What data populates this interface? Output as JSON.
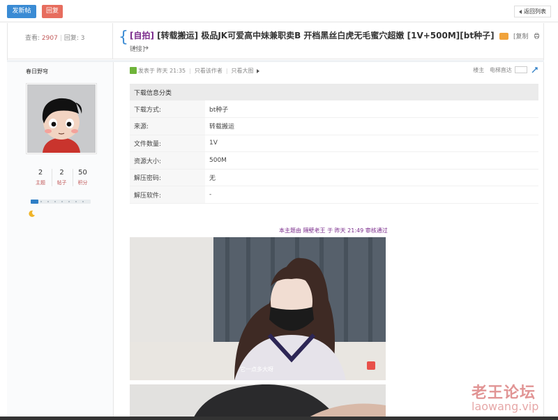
{
  "toolbar": {
    "new_post": "发新帖",
    "reply": "回复",
    "back": "返回列表"
  },
  "thread": {
    "views_label": "查看:",
    "views": "2907",
    "replies_label": "回复:",
    "replies": "3",
    "tag1": "[自拍]",
    "tag2": "[转载搬运]",
    "title": "极品JK可爱高中妹兼职卖B 开档黑丝白虎无毛蜜穴超嫩 [1V+500M][bt种子]",
    "copy_label": "[复制",
    "link_label": "链接]"
  },
  "author": {
    "name": "春日野穹",
    "stats": [
      {
        "value": "2",
        "label": "主题"
      },
      {
        "value": "2",
        "label": "帖子"
      },
      {
        "value": "50",
        "label": "积分"
      }
    ],
    "level_progress": 0.13
  },
  "post": {
    "posted_at": "发表于 昨天 21:35",
    "only_author": "只看该作者",
    "only_image": "只看大图",
    "role": "楼主",
    "goto_floor": "电梯直达",
    "table_title": "下载信息分类",
    "rows": [
      {
        "key": "下载方式:",
        "value": "bt种子"
      },
      {
        "key": "来源:",
        "value": "转载搬运"
      },
      {
        "key": "文件数量:",
        "value": "1V"
      },
      {
        "key": "资源大小:",
        "value": "500M"
      },
      {
        "key": "解压密码:",
        "value": "无"
      },
      {
        "key": "解压软件:",
        "value": "-"
      }
    ],
    "audit_note": "本主题由 隔壁老王 于 昨天 21:49 审核通过",
    "image_caption": "它一点多大呀"
  },
  "watermark": {
    "cn": "老王论坛",
    "url": "laowang.vip"
  },
  "colors": {
    "primary_blue": "#3a8bd4",
    "reply_red": "#e76d5e",
    "tag_purple": "#7b2c8c",
    "stat_red": "#c15858"
  }
}
